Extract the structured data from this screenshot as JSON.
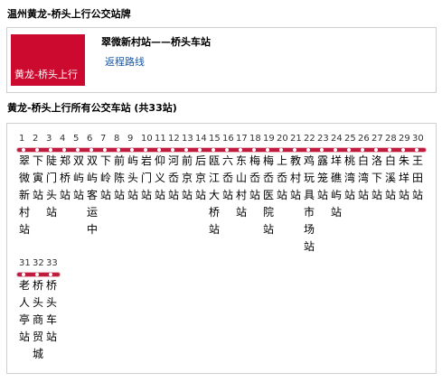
{
  "header": {
    "title": "温州黄龙-桥头上行公交站牌"
  },
  "route_card": {
    "logo_text": "黄龙-桥头上行",
    "route_name": "翠微新村站——桥头车站",
    "return_link": "返程路线"
  },
  "stops_section": {
    "title": "黄龙-桥头上行所有公交车站 (共33站)"
  },
  "stops": [
    {
      "num": "1",
      "name": "翠微新村站"
    },
    {
      "num": "2",
      "name": "下寅站"
    },
    {
      "num": "3",
      "name": "陡门头站"
    },
    {
      "num": "4",
      "name": "郑桥站"
    },
    {
      "num": "5",
      "name": "双屿站"
    },
    {
      "num": "6",
      "name": "双屿客运中"
    },
    {
      "num": "7",
      "name": "下岭站"
    },
    {
      "num": "8",
      "name": "前陈站"
    },
    {
      "num": "9",
      "name": "屿头站"
    },
    {
      "num": "10",
      "name": "岩门站"
    },
    {
      "num": "11",
      "name": "仰义站"
    },
    {
      "num": "12",
      "name": "河岙站"
    },
    {
      "num": "13",
      "name": "前京站"
    },
    {
      "num": "14",
      "name": "后京站"
    },
    {
      "num": "15",
      "name": "瓯江大桥站"
    },
    {
      "num": "16",
      "name": "六岙站"
    },
    {
      "num": "17",
      "name": "东山村站"
    },
    {
      "num": "18",
      "name": "梅岙站"
    },
    {
      "num": "19",
      "name": "梅岙医院站"
    },
    {
      "num": "20",
      "name": "上岙站"
    },
    {
      "num": "21",
      "name": "教村站"
    },
    {
      "num": "22",
      "name": "鸡玩具市场站"
    },
    {
      "num": "23",
      "name": "露笼站"
    },
    {
      "num": "24",
      "name": "垟礁屿站"
    },
    {
      "num": "25",
      "name": "桃湾站"
    },
    {
      "num": "26",
      "name": "白湾站"
    },
    {
      "num": "27",
      "name": "洛下站"
    },
    {
      "num": "28",
      "name": "白溪站"
    },
    {
      "num": "29",
      "name": "朱垟站"
    },
    {
      "num": "30",
      "name": "王田站"
    },
    {
      "num": "31",
      "name": "老人亭站"
    },
    {
      "num": "32",
      "name": "桥头商贸城"
    },
    {
      "num": "33",
      "name": "桥头车站"
    }
  ]
}
